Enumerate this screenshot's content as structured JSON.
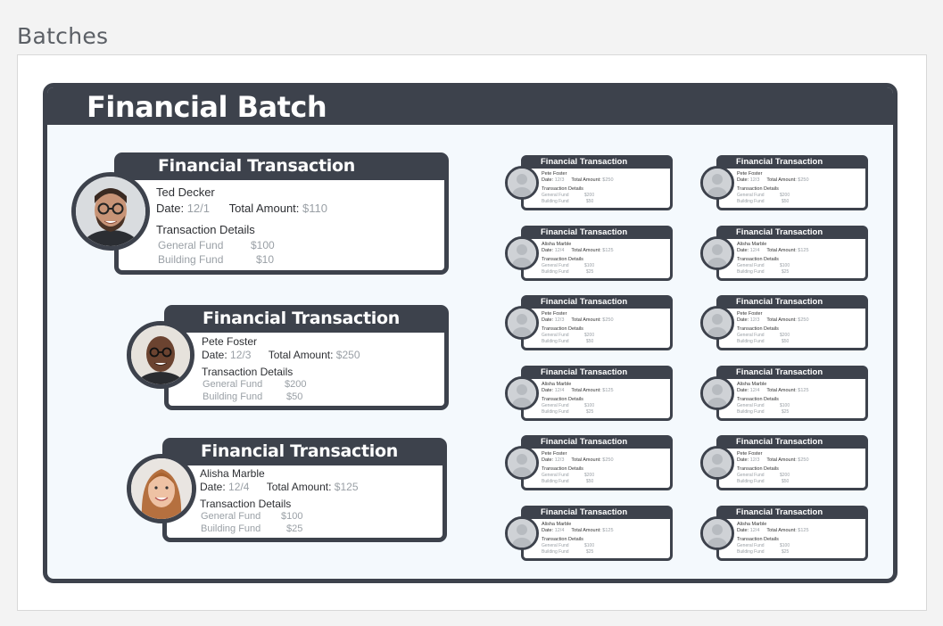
{
  "page": {
    "title": "Batches"
  },
  "batch": {
    "title": "Financial Batch"
  },
  "transactions_large": [
    {
      "title": "Financial Transaction",
      "name": "Ted Decker",
      "date_label": "Date:",
      "date": "12/1",
      "total_label": "Total Amount:",
      "total": "$110",
      "details_title": "Transaction Details",
      "funds": [
        {
          "fund": "General Fund",
          "amount": "$100"
        },
        {
          "fund": "Building Fund",
          "amount": "$10"
        }
      ]
    },
    {
      "title": "Financial Transaction",
      "name": "Pete Foster",
      "date_label": "Date:",
      "date": "12/3",
      "total_label": "Total Amount:",
      "total": "$250",
      "details_title": "Transaction Details",
      "funds": [
        {
          "fund": "General Fund",
          "amount": "$200"
        },
        {
          "fund": "Building Fund",
          "amount": "$50"
        }
      ]
    },
    {
      "title": "Financial Transaction",
      "name": "Alisha Marble",
      "date_label": "Date:",
      "date": "12/4",
      "total_label": "Total Amount:",
      "total": "$125",
      "details_title": "Transaction Details",
      "funds": [
        {
          "fund": "General Fund",
          "amount": "$100"
        },
        {
          "fund": "Building Fund",
          "amount": "$25"
        }
      ]
    }
  ],
  "transactions_small": [
    {
      "title": "Financial Transaction",
      "name": "Pete Foster",
      "date_label": "Date:",
      "date": "12/3",
      "total_label": "Total Amount:",
      "total": "$250",
      "details_title": "Transaction Details",
      "funds": [
        {
          "fund": "General Fund",
          "amount": "$200"
        },
        {
          "fund": "Building Fund",
          "amount": "$50"
        }
      ]
    },
    {
      "title": "Financial Transaction",
      "name": "Pete Foster",
      "date_label": "Date:",
      "date": "12/3",
      "total_label": "Total Amount:",
      "total": "$250",
      "details_title": "Transaction Details",
      "funds": [
        {
          "fund": "General Fund",
          "amount": "$200"
        },
        {
          "fund": "Building Fund",
          "amount": "$50"
        }
      ]
    },
    {
      "title": "Financial Transaction",
      "name": "Alisha Marble",
      "date_label": "Date:",
      "date": "12/4",
      "total_label": "Total Amount:",
      "total": "$125",
      "details_title": "Transaction Details",
      "funds": [
        {
          "fund": "General Fund",
          "amount": "$100"
        },
        {
          "fund": "Building Fund",
          "amount": "$25"
        }
      ]
    },
    {
      "title": "Financial Transaction",
      "name": "Alisha Marble",
      "date_label": "Date:",
      "date": "12/4",
      "total_label": "Total Amount:",
      "total": "$125",
      "details_title": "Transaction Details",
      "funds": [
        {
          "fund": "General Fund",
          "amount": "$100"
        },
        {
          "fund": "Building Fund",
          "amount": "$25"
        }
      ]
    },
    {
      "title": "Financial Transaction",
      "name": "Pete Foster",
      "date_label": "Date:",
      "date": "12/3",
      "total_label": "Total Amount:",
      "total": "$250",
      "details_title": "Transaction Details",
      "funds": [
        {
          "fund": "General Fund",
          "amount": "$200"
        },
        {
          "fund": "Building Fund",
          "amount": "$50"
        }
      ]
    },
    {
      "title": "Financial Transaction",
      "name": "Pete Foster",
      "date_label": "Date:",
      "date": "12/3",
      "total_label": "Total Amount:",
      "total": "$250",
      "details_title": "Transaction Details",
      "funds": [
        {
          "fund": "General Fund",
          "amount": "$200"
        },
        {
          "fund": "Building Fund",
          "amount": "$50"
        }
      ]
    },
    {
      "title": "Financial Transaction",
      "name": "Alisha Marble",
      "date_label": "Date:",
      "date": "12/4",
      "total_label": "Total Amount:",
      "total": "$125",
      "details_title": "Transaction Details",
      "funds": [
        {
          "fund": "General Fund",
          "amount": "$100"
        },
        {
          "fund": "Building Fund",
          "amount": "$25"
        }
      ]
    },
    {
      "title": "Financial Transaction",
      "name": "Alisha Marble",
      "date_label": "Date:",
      "date": "12/4",
      "total_label": "Total Amount:",
      "total": "$125",
      "details_title": "Transaction Details",
      "funds": [
        {
          "fund": "General Fund",
          "amount": "$100"
        },
        {
          "fund": "Building Fund",
          "amount": "$25"
        }
      ]
    },
    {
      "title": "Financial Transaction",
      "name": "Pete Foster",
      "date_label": "Date:",
      "date": "12/3",
      "total_label": "Total Amount:",
      "total": "$250",
      "details_title": "Transaction Details",
      "funds": [
        {
          "fund": "General Fund",
          "amount": "$200"
        },
        {
          "fund": "Building Fund",
          "amount": "$50"
        }
      ]
    },
    {
      "title": "Financial Transaction",
      "name": "Pete Foster",
      "date_label": "Date:",
      "date": "12/3",
      "total_label": "Total Amount:",
      "total": "$250",
      "details_title": "Transaction Details",
      "funds": [
        {
          "fund": "General Fund",
          "amount": "$200"
        },
        {
          "fund": "Building Fund",
          "amount": "$50"
        }
      ]
    },
    {
      "title": "Financial Transaction",
      "name": "Alisha Marble",
      "date_label": "Date:",
      "date": "12/4",
      "total_label": "Total Amount:",
      "total": "$125",
      "details_title": "Transaction Details",
      "funds": [
        {
          "fund": "General Fund",
          "amount": "$100"
        },
        {
          "fund": "Building Fund",
          "amount": "$25"
        }
      ]
    },
    {
      "title": "Financial Transaction",
      "name": "Alisha Marble",
      "date_label": "Date:",
      "date": "12/4",
      "total_label": "Total Amount:",
      "total": "$125",
      "details_title": "Transaction Details",
      "funds": [
        {
          "fund": "General Fund",
          "amount": "$100"
        },
        {
          "fund": "Building Fund",
          "amount": "$25"
        }
      ]
    }
  ],
  "colors": {
    "dark": "#3d424c",
    "canvas": "#f4f9fd",
    "muted": "#9aa0a6"
  }
}
